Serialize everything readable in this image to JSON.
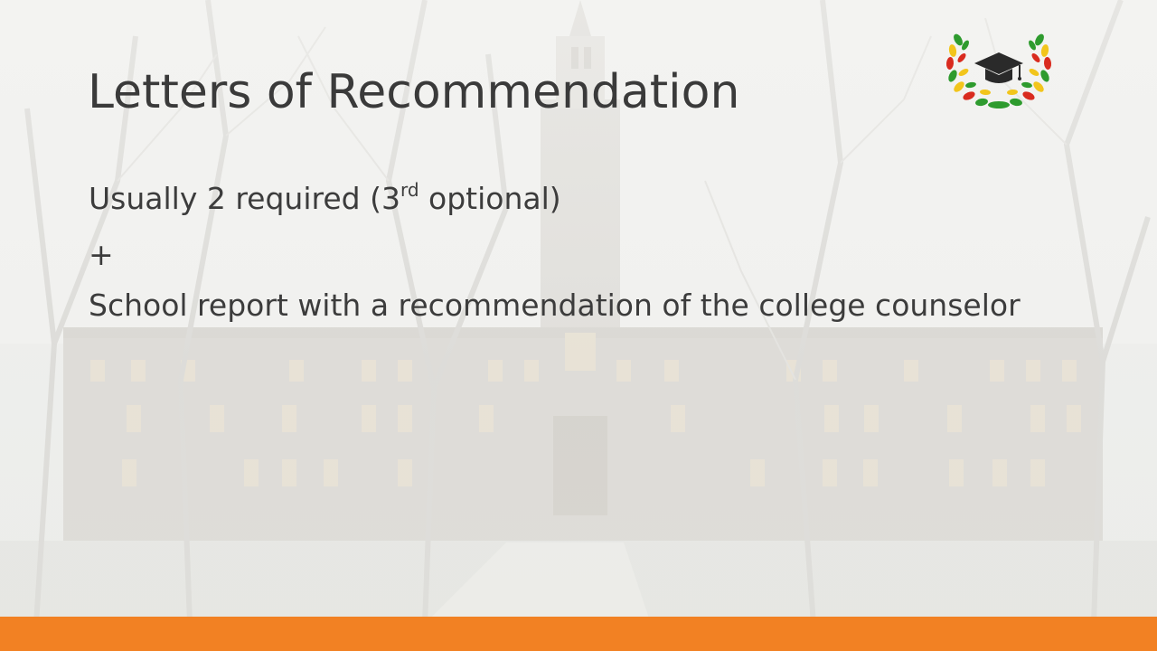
{
  "slide": {
    "title": "Letters of Recommendation",
    "line1_main": "Usually 2 required (3",
    "line1_sup": "rd",
    "line1_tail": " optional)",
    "line2": "+",
    "line3": "School report with a recommendation of the college counselor"
  },
  "logo": {
    "icon": "graduation-cap-laurel-icon",
    "laurel_colors": [
      "#2e9b2e",
      "#f2c51c",
      "#d92b1f"
    ],
    "cap_color": "#2a2a2a"
  },
  "theme": {
    "footer_color": "#f28123",
    "text_color": "#3a3a3a"
  }
}
